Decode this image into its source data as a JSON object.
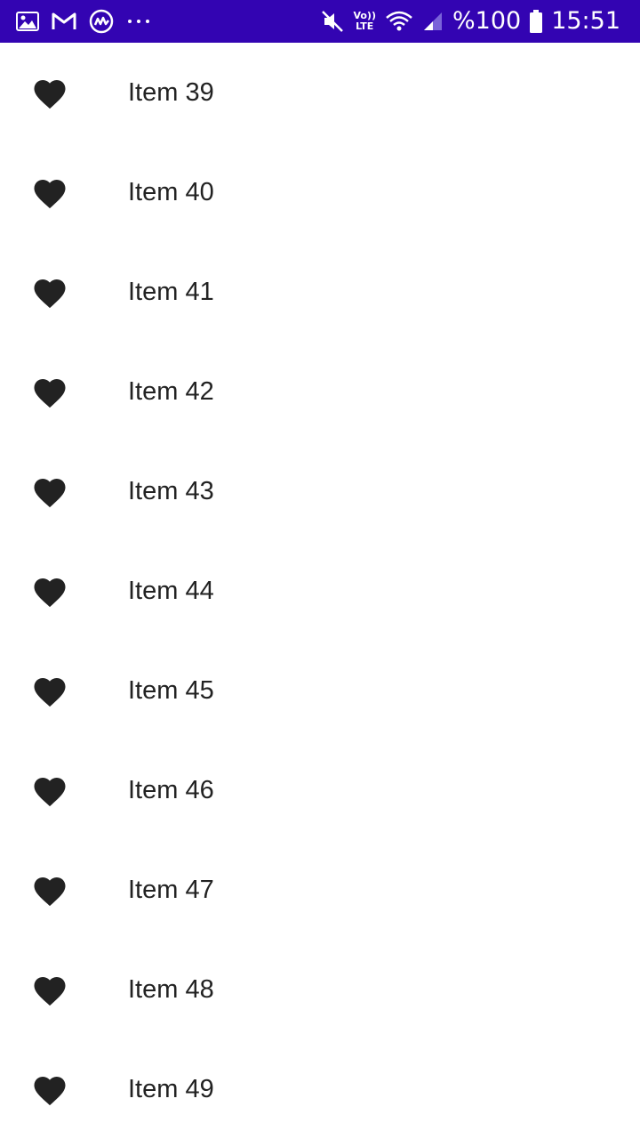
{
  "status_bar": {
    "background": "#3304b2",
    "left_icons": [
      "gallery-icon",
      "gmail-icon",
      "coinmarket-icon",
      "more-notifications-icon"
    ],
    "volte_label_top": "Vo))",
    "volte_label_bottom": "LTE",
    "battery_text": "%100",
    "time": "15:51"
  },
  "list": {
    "items": [
      {
        "icon": "heart-icon",
        "label": "Item 39"
      },
      {
        "icon": "heart-icon",
        "label": "Item 40"
      },
      {
        "icon": "heart-icon",
        "label": "Item 41"
      },
      {
        "icon": "heart-icon",
        "label": "Item 42"
      },
      {
        "icon": "heart-icon",
        "label": "Item 43"
      },
      {
        "icon": "heart-icon",
        "label": "Item 44"
      },
      {
        "icon": "heart-icon",
        "label": "Item 45"
      },
      {
        "icon": "heart-icon",
        "label": "Item 46"
      },
      {
        "icon": "heart-icon",
        "label": "Item 47"
      },
      {
        "icon": "heart-icon",
        "label": "Item 48"
      },
      {
        "icon": "heart-icon",
        "label": "Item 49"
      }
    ]
  }
}
